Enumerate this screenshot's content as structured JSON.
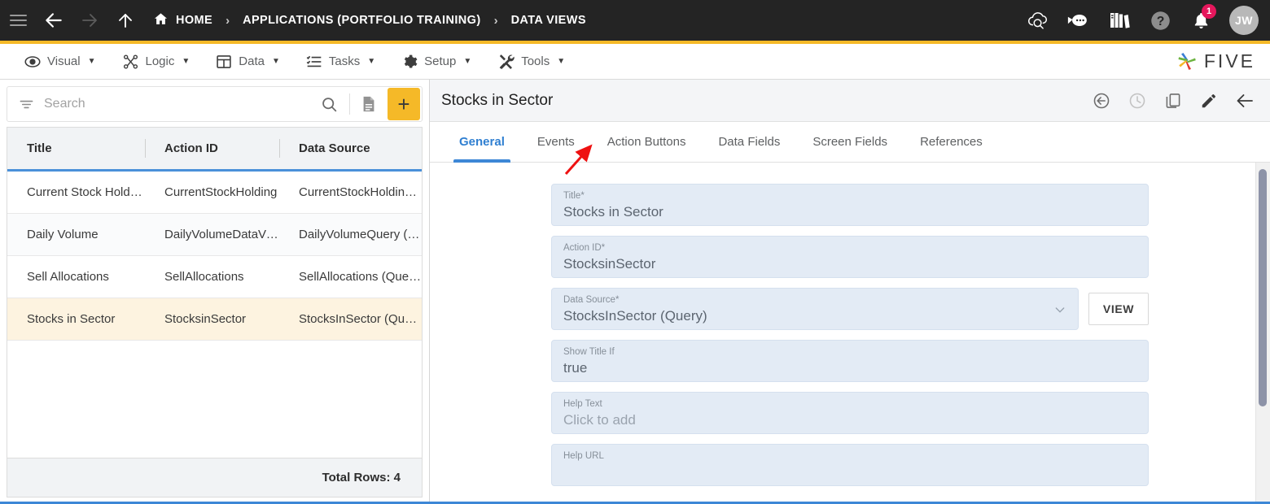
{
  "topbar": {
    "menu_icon": "hamburger-icon",
    "back_icon": "arrow-left-icon",
    "forward_icon": "arrow-right-icon",
    "up_icon": "arrow-up-icon",
    "breadcrumb": [
      {
        "label": "HOME",
        "icon": "home-icon"
      },
      {
        "label": "APPLICATIONS (PORTFOLIO TRAINING)",
        "icon": ""
      },
      {
        "label": "DATA VIEWS",
        "icon": ""
      }
    ],
    "separator": "›",
    "actions": [
      {
        "name": "cloud-search-icon",
        "label": ""
      },
      {
        "name": "chat-bot-icon",
        "label": ""
      },
      {
        "name": "books-icon",
        "label": ""
      },
      {
        "name": "help-icon",
        "label": ""
      }
    ],
    "notification_count": "1",
    "avatar_initials": "JW",
    "bg_color": "#242424",
    "accent_color": "#f5b928"
  },
  "menubar": {
    "items": [
      {
        "label": "Visual",
        "icon": "eye-icon",
        "caret": "▼"
      },
      {
        "label": "Logic",
        "icon": "logic-graph-icon",
        "caret": "▼"
      },
      {
        "label": "Data",
        "icon": "table-icon",
        "caret": "▼"
      },
      {
        "label": "Tasks",
        "icon": "checklist-icon",
        "caret": "▼"
      },
      {
        "label": "Setup",
        "icon": "gear-icon",
        "caret": "▼"
      },
      {
        "label": "Tools",
        "icon": "tools-icon",
        "caret": "▼"
      }
    ],
    "logo_text": "FIVE"
  },
  "left_panel": {
    "search": {
      "placeholder": "Search",
      "value": "",
      "filter_icon": "filter-icon",
      "search_icon": "search-icon"
    },
    "doc_button_icon": "document-icon",
    "add_button_label": "+",
    "columns": [
      "Title",
      "Action ID",
      "Data Source"
    ],
    "rows": [
      {
        "title": "Current Stock Holding",
        "action_id": "CurrentStockHolding",
        "data_source": "CurrentStockHoldin…"
      },
      {
        "title": "Daily Volume",
        "action_id": "DailyVolumeDataView",
        "data_source": "DailyVolumeQuery (…"
      },
      {
        "title": "Sell Allocations",
        "action_id": "SellAllocations",
        "data_source": "SellAllocations (Que…"
      },
      {
        "title": "Stocks in Sector",
        "action_id": "StocksinSector",
        "data_source": "StocksInSector (Que…"
      }
    ],
    "selected_row_index": 3,
    "footer": "Total Rows: 4",
    "selected_row_color": "#fdf3e0",
    "header_underline_color": "#4a90d9"
  },
  "right_panel": {
    "title": "Stocks in Sector",
    "header_icons": [
      {
        "name": "revert-icon"
      },
      {
        "name": "history-clock-icon"
      },
      {
        "name": "duplicate-icon"
      },
      {
        "name": "edit-pencil-icon"
      },
      {
        "name": "back-arrow-icon"
      }
    ],
    "tabs": [
      {
        "label": "General",
        "active": true
      },
      {
        "label": "Events",
        "active": false
      },
      {
        "label": "Action Buttons",
        "active": false
      },
      {
        "label": "Data Fields",
        "active": false
      },
      {
        "label": "Screen Fields",
        "active": false
      },
      {
        "label": "References",
        "active": false
      }
    ],
    "active_tab_color": "#3d87d6",
    "fields": [
      {
        "label": "Title",
        "required": true,
        "value": "Stocks in Sector",
        "type": "text"
      },
      {
        "label": "Action ID",
        "required": true,
        "value": "StocksinSector",
        "type": "text"
      },
      {
        "label": "Data Source",
        "required": true,
        "value": "StocksInSector (Query)",
        "type": "select",
        "button": "VIEW"
      },
      {
        "label": "Show Title If",
        "required": false,
        "value": "true",
        "type": "text"
      },
      {
        "label": "Help Text",
        "required": false,
        "value": "Click to add",
        "type": "text",
        "muted": true
      },
      {
        "label": "Help URL",
        "required": false,
        "value": "",
        "type": "text"
      }
    ],
    "required_marker": "*"
  },
  "annotation": {
    "type": "red-arrow",
    "points_to": "Action Buttons",
    "color": "#ee1111"
  }
}
